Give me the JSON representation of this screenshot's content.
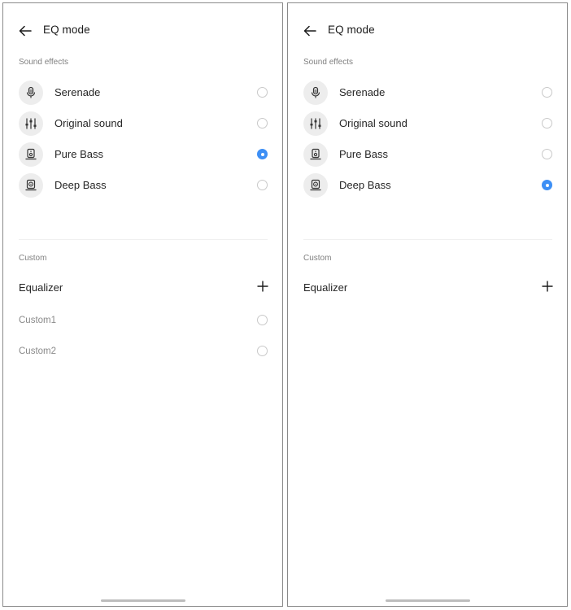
{
  "screen": {
    "title": "EQ mode",
    "sound_effects_label": "Sound effects",
    "custom_label": "Custom",
    "equalizer_label": "Equalizer"
  },
  "left_panel": {
    "effects": [
      {
        "label": "Serenade",
        "icon": "microphone-icon",
        "selected": false
      },
      {
        "label": "Original sound",
        "icon": "sliders-icon",
        "selected": false
      },
      {
        "label": "Pure Bass",
        "icon": "speaker-icon",
        "selected": true
      },
      {
        "label": "Deep Bass",
        "icon": "subwoofer-icon",
        "selected": false
      }
    ],
    "custom_presets": [
      {
        "label": "Custom1",
        "selected": false
      },
      {
        "label": "Custom2",
        "selected": false
      }
    ]
  },
  "right_panel": {
    "effects": [
      {
        "label": "Serenade",
        "icon": "microphone-icon",
        "selected": false
      },
      {
        "label": "Original sound",
        "icon": "sliders-icon",
        "selected": false
      },
      {
        "label": "Pure Bass",
        "icon": "speaker-icon",
        "selected": false
      },
      {
        "label": "Deep Bass",
        "icon": "subwoofer-icon",
        "selected": true
      }
    ],
    "custom_presets": []
  },
  "colors": {
    "accent": "#3d8ff5",
    "icon_bg": "#ededed",
    "border": "#8a8a8a",
    "secondary_text": "#808080"
  }
}
